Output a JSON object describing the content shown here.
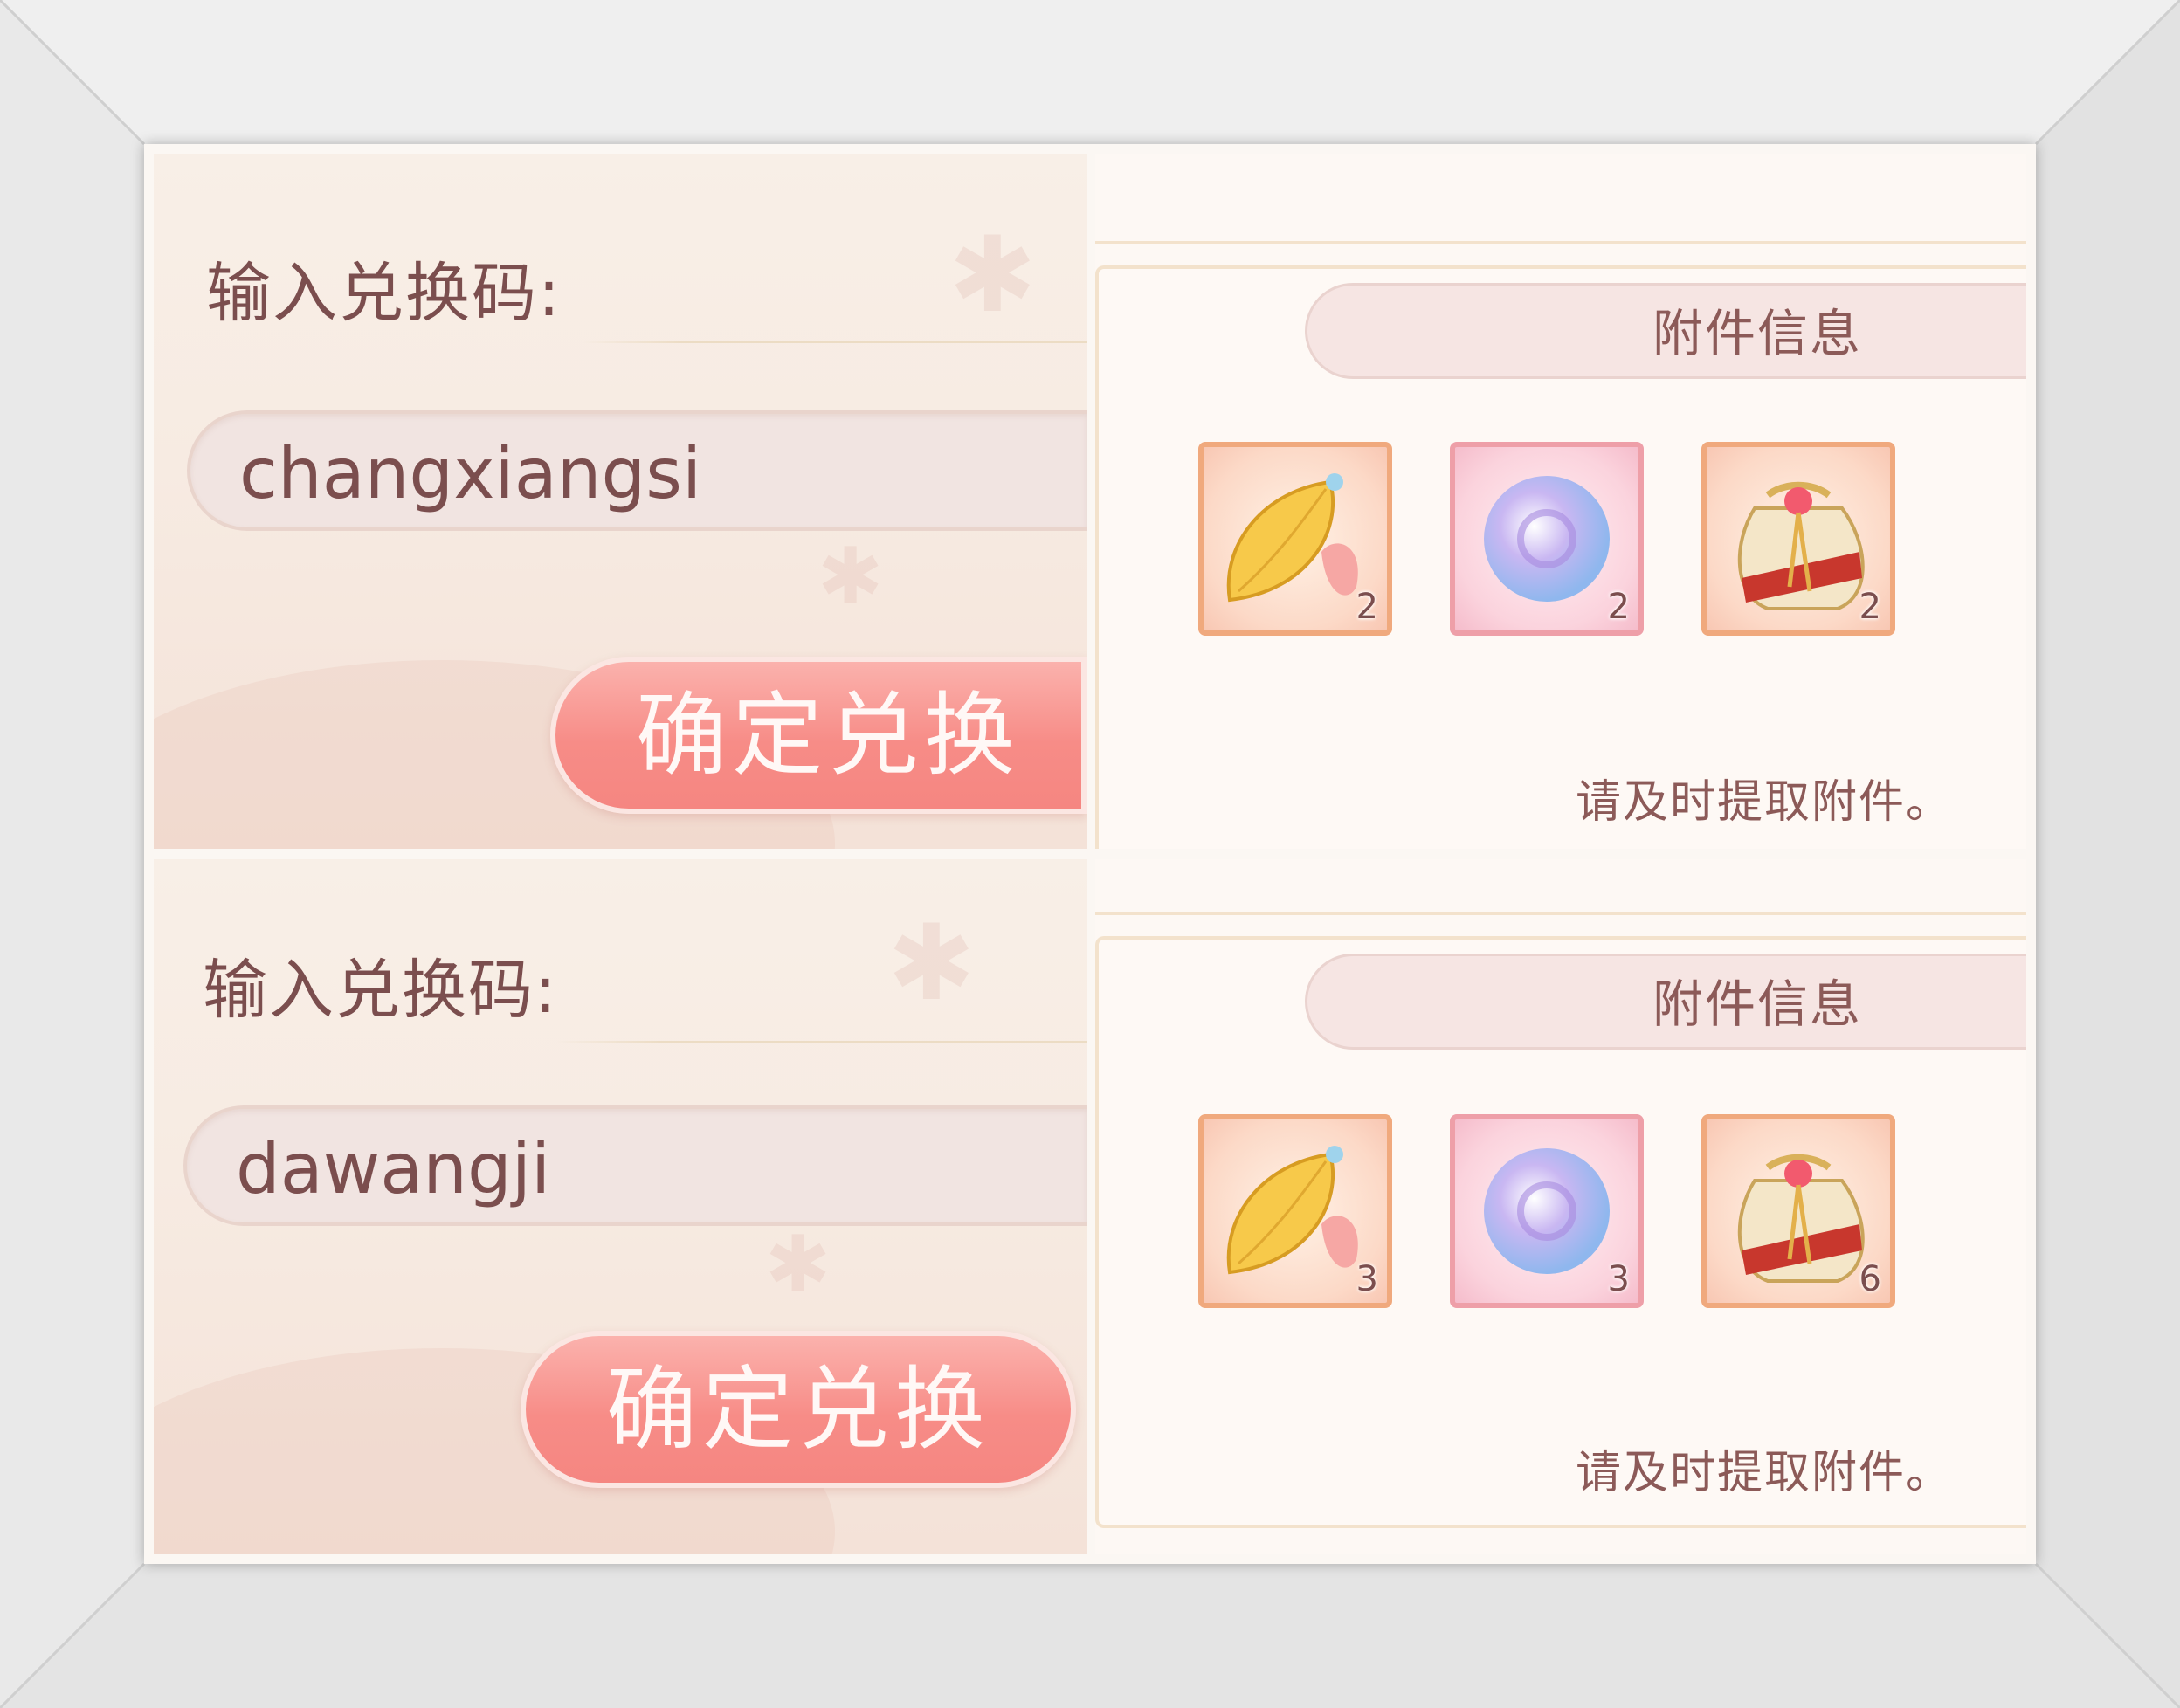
{
  "panels": [
    {
      "code_label": "输入兑换码:",
      "code_value": "changxiangsi",
      "confirm_label": "确定兑换",
      "attachment_title": "附件信息",
      "items": [
        {
          "icon": "golden-leaf-pendant-icon",
          "count": "2"
        },
        {
          "icon": "crystal-orb-icon",
          "count": "2"
        },
        {
          "icon": "gift-pouch-icon",
          "count": "2"
        }
      ],
      "notice": "请及时提取附件。"
    },
    {
      "code_label": "输入兑换码:",
      "code_value": "dawangji",
      "confirm_label": "确定兑换",
      "attachment_title": "附件信息",
      "items": [
        {
          "icon": "golden-leaf-pendant-icon",
          "count": "3"
        },
        {
          "icon": "crystal-orb-icon",
          "count": "3"
        },
        {
          "icon": "gift-pouch-icon",
          "count": "6"
        }
      ],
      "notice": "请及时提取附件。"
    }
  ],
  "colors": {
    "text": "#7b4e4e",
    "button": "#f78c87",
    "frame": "#e8e8e8"
  }
}
